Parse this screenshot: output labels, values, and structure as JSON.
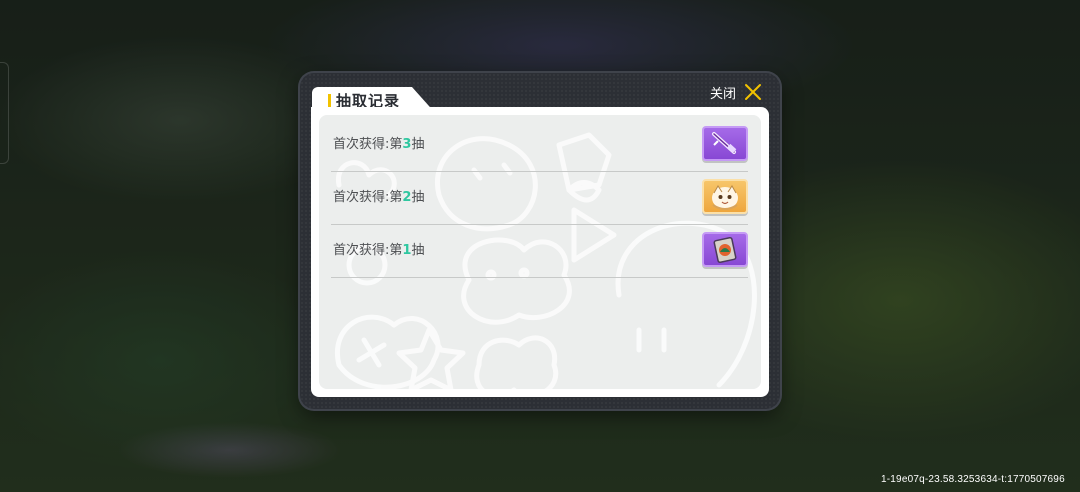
{
  "dialog": {
    "title": "抽取记录",
    "close_label": "关闭"
  },
  "records": [
    {
      "prefix": "首次获得:第",
      "number": "3",
      "suffix": "抽",
      "item_icon": "purple-weapon-icon",
      "rarity_color": "#9b5de5"
    },
    {
      "prefix": "首次获得:第",
      "number": "2",
      "suffix": "抽",
      "item_icon": "orange-character-icon",
      "rarity_color": "#f0b040"
    },
    {
      "prefix": "首次获得:第",
      "number": "1",
      "suffix": "抽",
      "item_icon": "purple-card-icon",
      "rarity_color": "#9b5de5"
    }
  ],
  "footer": {
    "build_id": "1-19e07q-23.58.3253634-t:1770507696"
  },
  "colors": {
    "accent": "#f2c200",
    "number_highlight": "#2fc7a0"
  }
}
